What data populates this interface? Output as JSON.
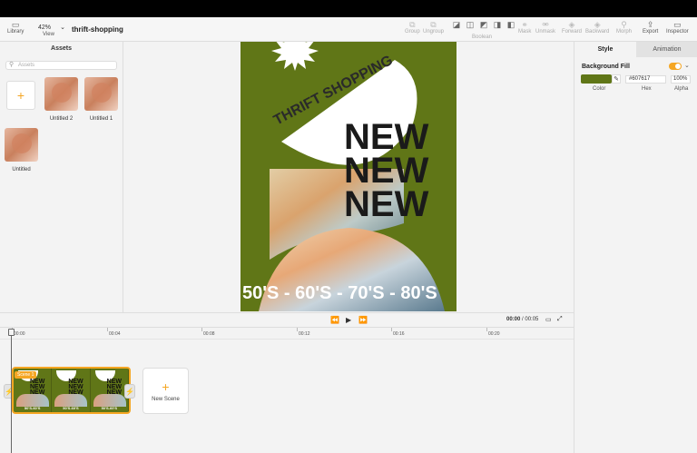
{
  "app": {
    "title": "thrift-shopping"
  },
  "toolbar": {
    "library_label": "Library",
    "view_label": "View",
    "zoom_value": "42%",
    "group_label": "Group",
    "ungroup_label": "Ungroup",
    "boolean_label": "Boolean",
    "mask_label": "Mask",
    "unmask_label": "Unmask",
    "forward_label": "Forward",
    "backward_label": "Backward",
    "morph_label": "Morph",
    "export_label": "Export",
    "inspector_label": "Inspector"
  },
  "assets": {
    "title": "Assets",
    "search_placeholder": "Assets",
    "items": [
      {
        "label": "Untitled 2"
      },
      {
        "label": "Untitled 1"
      },
      {
        "label": "Untitled"
      }
    ]
  },
  "poster": {
    "curved_text": "THRIFT SHOPPING",
    "headline": [
      "NEW",
      "NEW",
      "NEW"
    ],
    "footer_text": "50'S - 60'S - 70'S - 80'S",
    "bg_color": "#607617"
  },
  "inspector": {
    "tabs": [
      {
        "label": "Style"
      },
      {
        "label": "Animation"
      }
    ],
    "background_fill_label": "Background Fill",
    "hex_value": "#607617",
    "alpha_value": "100%",
    "color_label": "Color",
    "hex_label": "Hex",
    "alpha_label": "Alpha",
    "accent": "#f5a623"
  },
  "transport": {
    "current_time": "00:00",
    "total_time": "/ 00:05"
  },
  "ruler": {
    "ticks": [
      "00:00",
      "00:04",
      "00:08",
      "00:12",
      "00:16",
      "00:20"
    ]
  },
  "timeline": {
    "scene_label": "Scene 1",
    "frame_headline": "NEW",
    "frame_footer": "50'S-60'S",
    "new_scene_label": "New Scene"
  }
}
